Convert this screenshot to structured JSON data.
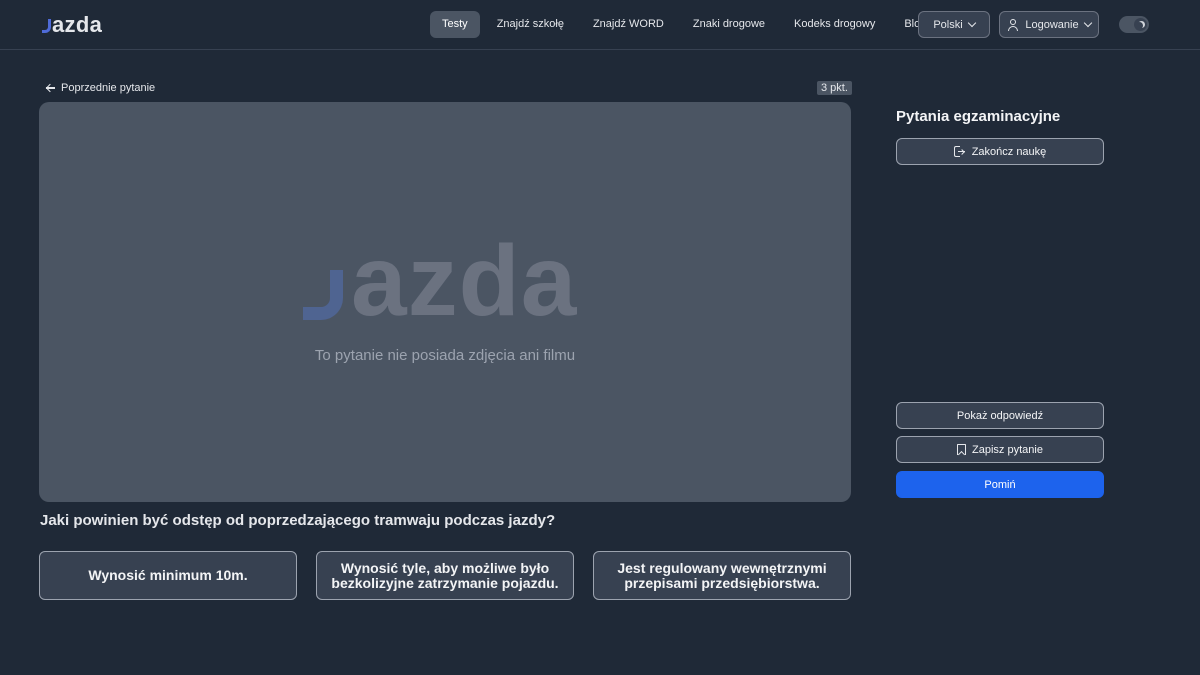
{
  "header": {
    "logo": "azda",
    "nav": [
      {
        "label": "Testy",
        "active": true
      },
      {
        "label": "Znajdź szkołę",
        "active": false
      },
      {
        "label": "Znajdź WORD",
        "active": false
      },
      {
        "label": "Znaki drogowe",
        "active": false
      },
      {
        "label": "Kodeks drogowy",
        "active": false
      },
      {
        "label": "Blog",
        "active": false
      }
    ],
    "language": "Polski",
    "login": "Logowanie",
    "theme_toggle_icon": "moon-icon"
  },
  "main": {
    "prev_label": "Poprzednie pytanie",
    "points": "3 pkt.",
    "media": {
      "logo": "azda",
      "caption": "To pytanie nie posiada zdjęcia ani filmu"
    },
    "question": "Jaki powinien być odstęp od poprzedzającego tramwaju podczas jazdy?",
    "answers": [
      "Wynosić minimum 10m.",
      "Wynosić tyle, aby możliwe było bezkolizyjne zatrzymanie pojazdu.",
      "Jest regulowany wewnętrznymi przepisami przedsiębiorstwa."
    ]
  },
  "side": {
    "title": "Pytania egzaminacyjne",
    "finish": "Zakończ naukę",
    "show_answer": "Pokaż odpowiedź",
    "save_question": "Zapisz pytanie",
    "skip": "Pomiń"
  },
  "colors": {
    "background": "#1f2937",
    "accent": "#1d63ed",
    "logo_mark": "#4f6bd8"
  }
}
